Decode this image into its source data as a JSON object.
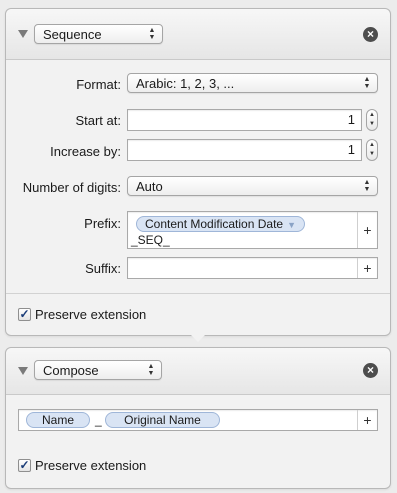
{
  "sequence_panel": {
    "mode_label": "Sequence",
    "format_label": "Format:",
    "format_value": "Arabic: 1, 2, 3, ...",
    "start_label": "Start at:",
    "start_value": "1",
    "increase_label": "Increase by:",
    "increase_value": "1",
    "digits_label": "Number of digits:",
    "digits_value": "Auto",
    "prefix_label": "Prefix:",
    "prefix_token": "Content Modification Date",
    "prefix_text": "_SEQ_",
    "suffix_label": "Suffix:",
    "preserve_label": "Preserve extension",
    "preserve_checked": true
  },
  "compose_panel": {
    "mode_label": "Compose",
    "tokens": [
      "Name",
      "Original Name"
    ],
    "separator": "_",
    "preserve_label": "Preserve extension",
    "preserve_checked": true
  },
  "icons": {
    "close": "close-icon",
    "add": "plus-icon",
    "disclosure": "disclosure-triangle-icon",
    "stepper": "stepper-arrows-icon",
    "popup": "popup-arrows-icon"
  }
}
